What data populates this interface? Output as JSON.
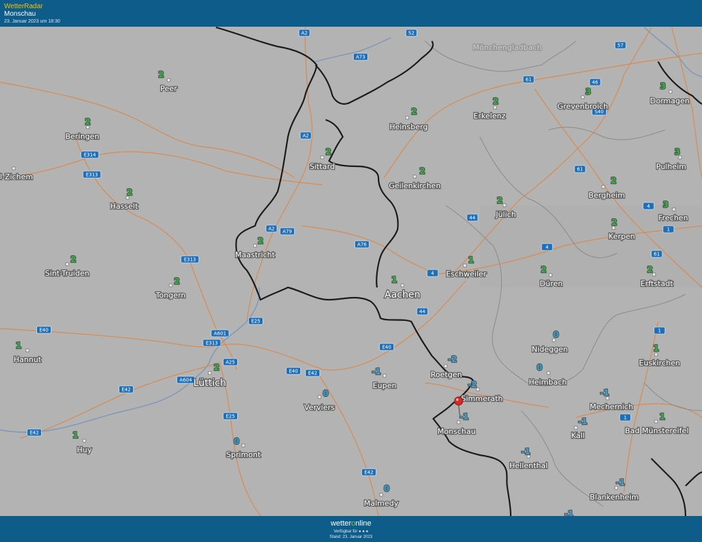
{
  "header": {
    "app_title": "WetterRadar",
    "location": "Monschau",
    "timestamp": "23. Januar 2023 um 18:30"
  },
  "footer": {
    "brand_prefix": "wetter",
    "brand_o": "o",
    "brand_suffix": "nline",
    "available": "Verfügbar für",
    "stand": "Stand: 23. Januar 2023"
  },
  "colors": {
    "positive_temp": "#2fb43f",
    "zero_temp": "#2c9ed3",
    "negative_temp": "#3aa5dd",
    "road": "#d98a4e",
    "border": "#1b1b1b",
    "bar": "#0d5c8a"
  },
  "places": [
    {
      "name": "Peer",
      "temp": "2"
    },
    {
      "name": "Beringen",
      "temp": "2"
    },
    {
      "name": "Hasselt",
      "temp": "2"
    },
    {
      "name": "l-Zichem",
      "temp": ""
    },
    {
      "name": "Sint-Truiden",
      "temp": "2"
    },
    {
      "name": "Tongern",
      "temp": "2"
    },
    {
      "name": "Hannut",
      "temp": "1"
    },
    {
      "name": "Huy",
      "temp": "1"
    },
    {
      "name": "Lüttich",
      "temp": "2"
    },
    {
      "name": "Sprimont",
      "temp": "0"
    },
    {
      "name": "Verviers",
      "temp": "0"
    },
    {
      "name": "Malmedy",
      "temp": "0"
    },
    {
      "name": "Eupen",
      "temp": "-1"
    },
    {
      "name": "Maastricht",
      "temp": "2"
    },
    {
      "name": "Sittard",
      "temp": "2"
    },
    {
      "name": "Heinsberg",
      "temp": "2"
    },
    {
      "name": "Geilenkirchen",
      "temp": "2"
    },
    {
      "name": "Erkelenz",
      "temp": "2"
    },
    {
      "name": "Jülich",
      "temp": "2"
    },
    {
      "name": "Eschweiler",
      "temp": "1"
    },
    {
      "name": "Aachen",
      "temp": "1"
    },
    {
      "name": "Roetgen",
      "temp": "-2"
    },
    {
      "name": "Simmerath",
      "temp": "-2"
    },
    {
      "name": "Monschau",
      "temp": "-1"
    },
    {
      "name": "Hellenthal",
      "temp": "-1"
    },
    {
      "name": "Düren",
      "temp": "2"
    },
    {
      "name": "Nideggen",
      "temp": "0"
    },
    {
      "name": "Heimbach",
      "temp": "0"
    },
    {
      "name": "Mechernich",
      "temp": "-1"
    },
    {
      "name": "Kall",
      "temp": "-1"
    },
    {
      "name": "Blankenheim",
      "temp": "-1"
    },
    {
      "name": "Grevenbroich",
      "temp": "3"
    },
    {
      "name": "Dormagen",
      "temp": "3"
    },
    {
      "name": "Pulheim",
      "temp": "3"
    },
    {
      "name": "Bergheim",
      "temp": "2"
    },
    {
      "name": "Kerpen",
      "temp": "2"
    },
    {
      "name": "Frechen",
      "temp": "3"
    },
    {
      "name": "Erftstadt",
      "temp": "2"
    },
    {
      "name": "Euskirchen",
      "temp": "1"
    },
    {
      "name": "Bad Münstereifel",
      "temp": "1"
    },
    {
      "name": "Mönchengladbach",
      "temp": ""
    },
    {
      "name": "",
      "temp": "-1"
    }
  ],
  "roads": [
    "A2",
    "A73",
    "52",
    "57",
    "61",
    "46",
    "S40",
    "E314",
    "E313",
    "A2",
    "A2",
    "A79",
    "A76",
    "E313",
    "4",
    "44",
    "44",
    "E25",
    "A601",
    "E313",
    "E40",
    "A25",
    "A604",
    "E42",
    "E42",
    "E25",
    "E40",
    "E42",
    "E40",
    "61",
    "4",
    "1",
    "4",
    "1",
    "1",
    "61",
    "E42"
  ]
}
